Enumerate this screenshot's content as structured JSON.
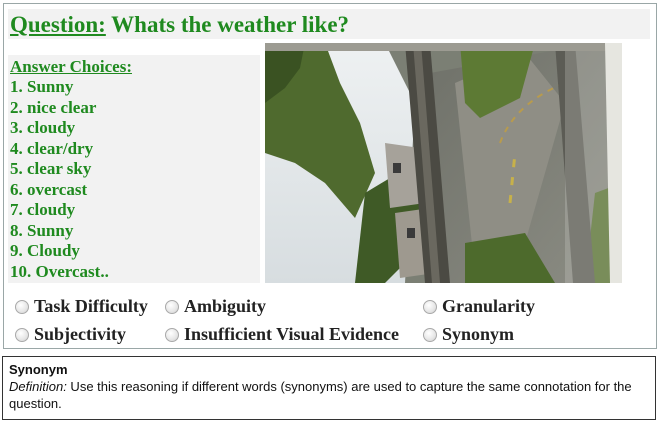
{
  "question": {
    "label": "Question:",
    "text": " Whats the weather like?"
  },
  "answers": {
    "heading": "Answer Choices:",
    "items": [
      "1. Sunny",
      "2. nice clear",
      "3. cloudy",
      "4. clear/dry",
      "5. clear sky",
      "6. overcast",
      "7. cloudy",
      "8. Sunny",
      "9. Cloudy",
      "10. Overcast.."
    ]
  },
  "options": [
    "Task Difficulty",
    "Ambiguity",
    "Granularity",
    "Subjectivity",
    "Insufficient Visual Evidence",
    "Synonym"
  ],
  "definition": {
    "term": "Synonym",
    "label": "Definition:",
    "text": "  Use this reasoning if different words (synonyms) are used to capture the same connotation for the question."
  },
  "colors": {
    "accent_green": "#1f8a1f"
  }
}
